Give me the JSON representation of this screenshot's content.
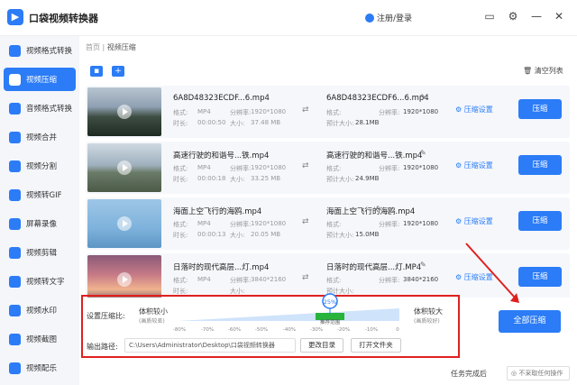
{
  "app": {
    "title": "口袋视频转换器",
    "user_label": "注册/登录"
  },
  "window_icons": [
    "folder-icon",
    "settings-icon",
    "minimize-icon",
    "close-icon"
  ],
  "sidebar": {
    "items": [
      {
        "label": "视频格式转换",
        "icon": "video-format-icon",
        "active": false
      },
      {
        "label": "视频压缩",
        "icon": "video-compress-icon",
        "active": true
      },
      {
        "label": "音频格式转换",
        "icon": "audio-format-icon",
        "active": false
      },
      {
        "label": "视频合并",
        "icon": "video-merge-icon",
        "active": false
      },
      {
        "label": "视频分割",
        "icon": "video-split-icon",
        "active": false
      },
      {
        "label": "视频转GIF",
        "icon": "gif-icon",
        "active": false
      },
      {
        "label": "屏幕录像",
        "icon": "screen-record-icon",
        "active": false
      },
      {
        "label": "视频剪辑",
        "icon": "video-edit-icon",
        "active": false
      },
      {
        "label": "视频转文字",
        "icon": "video-to-text-icon",
        "active": false
      },
      {
        "label": "视频水印",
        "icon": "watermark-icon",
        "active": false
      },
      {
        "label": "视频截图",
        "icon": "screenshot-icon",
        "active": false
      },
      {
        "label": "视频配乐",
        "icon": "music-icon",
        "active": false
      }
    ]
  },
  "breadcrumb": {
    "home": "首页",
    "sep": "|",
    "current": "视频压缩"
  },
  "toolbar": {
    "clear_label": "清空列表"
  },
  "labels": {
    "format": "格式:",
    "resolution": "分辨率:",
    "duration": "时长:",
    "size": "大小:",
    "est_size": "预计大小:",
    "settings": "压缩设置",
    "compress": "压缩"
  },
  "files": [
    {
      "name": "6A8D48323ECDF...6.mp4",
      "format": "MP4",
      "resolution": "1920*1080",
      "duration": "00:00:50",
      "size": "37.48 MB",
      "out_name": "6A8D48323ECDF6...6.mp4",
      "out_resolution": "1920*1080",
      "est_size": "28.1MB"
    },
    {
      "name": "高速行驶的和谐号...铁.mp4",
      "format": "MP4",
      "resolution": "1920*1080",
      "duration": "00:00:18",
      "size": "33.25 MB",
      "out_name": "高速行驶的和谐号...铁.mp4",
      "out_resolution": "1920*1080",
      "est_size": "24.9MB"
    },
    {
      "name": "海面上空飞行的海鸥.mp4",
      "format": "MP4",
      "resolution": "1920*1080",
      "duration": "00:00:13",
      "size": "20.05 MB",
      "out_name": "海面上空飞行的海鸥.mp4",
      "out_resolution": "1920*1080",
      "est_size": "15.0MB"
    },
    {
      "name": "日落时的现代高层...灯.mp4",
      "format": "MP4",
      "resolution": "3840*2160",
      "duration": "",
      "size": "",
      "out_name": "日落时的现代高层...灯.MP4",
      "out_resolution": "3840*2160",
      "est_size": ""
    }
  ],
  "compress": {
    "ratio_label": "设置压缩比:",
    "small_label": "体积较小",
    "small_sub": "(画质较差)",
    "large_label": "体积较大",
    "large_sub": "(画质较好)",
    "value": "25%",
    "recommend": "推荐范围",
    "ticks": [
      "-80%",
      "-70%",
      "-60%",
      "-50%",
      "-40%",
      "-30%",
      "-20%",
      "-10%",
      "0"
    ]
  },
  "output": {
    "label": "输出路径:",
    "path": "C:\\Users\\Administrator\\Desktop\\口袋视频转换器",
    "change_label": "更改目录",
    "open_label": "打开文件夹"
  },
  "compress_all_label": "全部压缩",
  "footer": {
    "after_label": "任务完成后",
    "after_value": "不采取任何操作"
  },
  "colors": {
    "accent": "#2b7cf6",
    "annotation": "#e02020",
    "recommend": "#28b33a"
  }
}
